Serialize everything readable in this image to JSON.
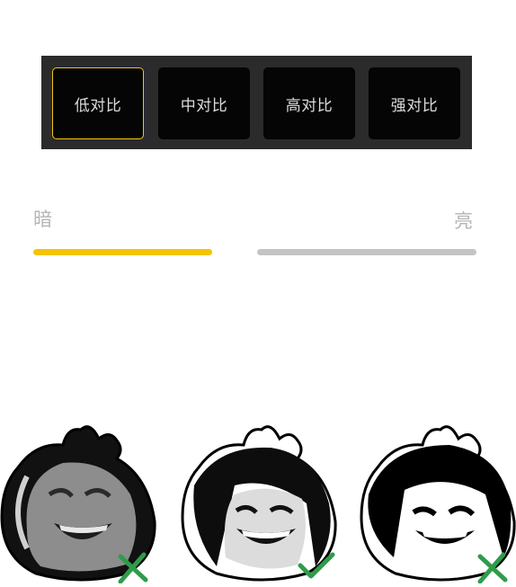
{
  "contrast_options": [
    {
      "label": "低对比",
      "selected": true
    },
    {
      "label": "中对比",
      "selected": false
    },
    {
      "label": "高对比",
      "selected": false
    },
    {
      "label": "强对比",
      "selected": false
    }
  ],
  "slider": {
    "left_label": "暗",
    "right_label": "亮",
    "value_fraction": 0.4
  },
  "samples": [
    {
      "icon": "cross-icon",
      "status": "bad"
    },
    {
      "icon": "check-icon",
      "status": "good"
    },
    {
      "icon": "cross-icon",
      "status": "bad"
    }
  ],
  "colors": {
    "accent": "#f2c317",
    "panel": "#2b2b2b",
    "button": "#050505",
    "track_inactive": "#c4c4c4",
    "mark_green": "#2e9c4a"
  }
}
